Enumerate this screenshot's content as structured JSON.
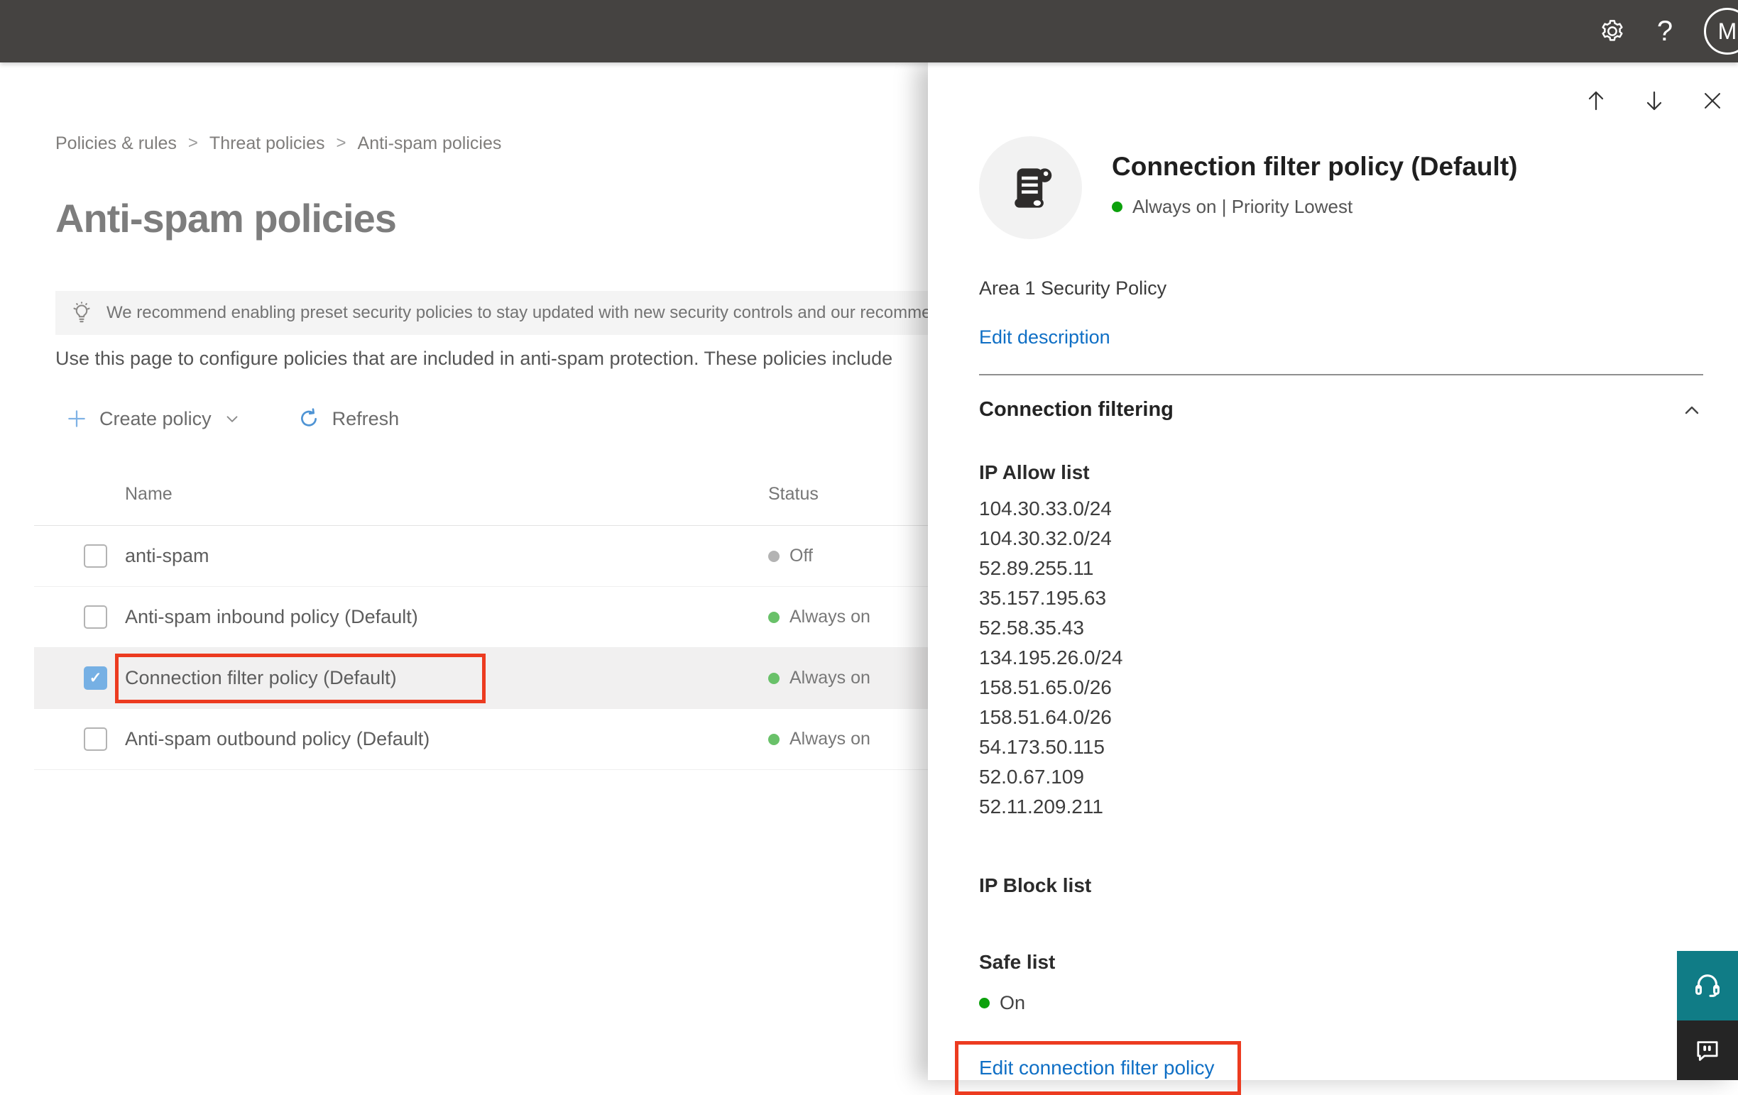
{
  "topbar": {
    "avatar_initial": "M",
    "help_label": "?"
  },
  "breadcrumb": {
    "items": [
      "Policies & rules",
      "Threat policies",
      "Anti-spam policies"
    ]
  },
  "page": {
    "title": "Anti-spam policies",
    "banner_text": "We recommend enabling preset security policies to stay updated with new security controls and our recomme",
    "description": "Use this page to configure policies that are included in anti-spam protection. These policies include"
  },
  "toolbar": {
    "create_policy_label": "Create policy",
    "refresh_label": "Refresh"
  },
  "table": {
    "columns": {
      "name": "Name",
      "status": "Status"
    },
    "rows": [
      {
        "name": "anti-spam",
        "status": "Off",
        "dot": "gray",
        "checked": false,
        "selected": false,
        "highlighted": false
      },
      {
        "name": "Anti-spam inbound policy (Default)",
        "status": "Always on",
        "dot": "green",
        "checked": false,
        "selected": false,
        "highlighted": false
      },
      {
        "name": "Connection filter policy (Default)",
        "status": "Always on",
        "dot": "green",
        "checked": true,
        "selected": true,
        "highlighted": true
      },
      {
        "name": "Anti-spam outbound policy (Default)",
        "status": "Always on",
        "dot": "green",
        "checked": false,
        "selected": false,
        "highlighted": false
      }
    ]
  },
  "panel": {
    "title": "Connection filter policy (Default)",
    "status_line": "Always on | Priority Lowest",
    "description": "Area 1 Security Policy",
    "edit_description_label": "Edit description",
    "section_title": "Connection filtering",
    "ip_allow_title": "IP Allow list",
    "ip_allow": [
      "104.30.33.0/24",
      "104.30.32.0/24",
      "52.89.255.11",
      "35.157.195.63",
      "52.58.35.43",
      "134.195.26.0/24",
      "158.51.65.0/26",
      "158.51.64.0/26",
      "54.173.50.115",
      "52.0.67.109",
      "52.11.209.211"
    ],
    "ip_block_title": "IP Block list",
    "safe_list_title": "Safe list",
    "safe_list_status": "On",
    "edit_link_label": "Edit connection filter policy"
  },
  "colors": {
    "topbar_bg": "#454341",
    "accent_blue": "#0f6fc5",
    "checkbox_blue": "#76b0e4",
    "highlight_red": "#ec3b20",
    "status_green": "#69c169",
    "status_green_bright": "#0ca10c",
    "status_gray": "#b3b3b3",
    "selected_row_bg": "#f1f0f0",
    "support_teal": "#107c86",
    "feedback_dark": "#252525"
  }
}
